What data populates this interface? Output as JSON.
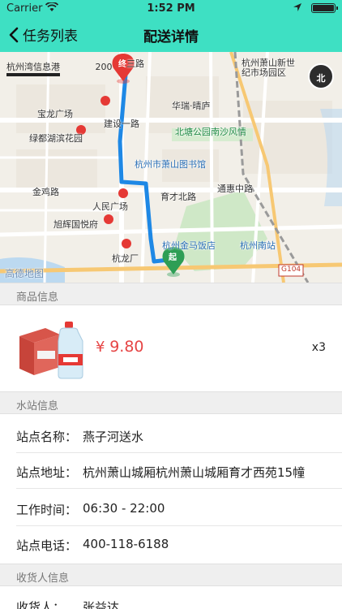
{
  "status_bar": {
    "carrier": "Carrier",
    "time": "1:52 PM",
    "icons": [
      "wifi-icon",
      "location-arrow-icon",
      "battery-icon"
    ]
  },
  "nav": {
    "back_label": "任务列表",
    "title": "配送详情",
    "background_color": "#3ee0c3"
  },
  "map": {
    "scale_label": "杭州湾信息港",
    "scale_distance": "200",
    "compass_label": "北",
    "start_marker": "起",
    "end_marker": "终",
    "labels": [
      "三路",
      "杭州萧山新世纪市场园区",
      "宝龙广场",
      "华瑞·晴庐",
      "建设一路",
      "北塘公园南沙风情",
      "绿都湖滨花园",
      "杭州市萧山图书馆",
      "金鸡路",
      "人民广场",
      "育才北路",
      "通惠中路",
      "旭辉国悦府",
      "杭州金马饭店",
      "杭州南站",
      "杭龙厂",
      "高德地图",
      "G104"
    ],
    "route_color": "#1e88e5"
  },
  "sections": {
    "product": "商品信息",
    "station": "水站信息",
    "recipient": "收货人信息"
  },
  "product": {
    "currency": "¥",
    "price": "9.80",
    "quantity": "x3"
  },
  "station": {
    "name_label": "站点名称：",
    "name": "燕子河送水",
    "address_label": "站点地址：",
    "address": "杭州萧山城厢杭州萧山城厢育才西苑15幢",
    "hours_label": "工作时间：",
    "hours": "06:30 - 22:00",
    "phone_label": "站点电话：",
    "phone": "400-118-6188"
  },
  "recipient": {
    "name_label": "收货人：",
    "name": "张益达"
  }
}
